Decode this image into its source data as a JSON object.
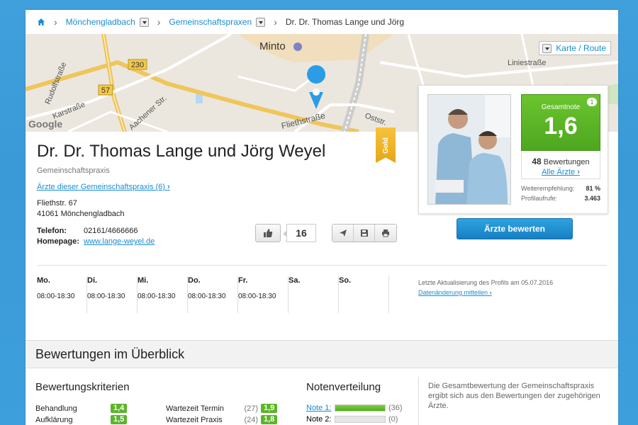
{
  "breadcrumb": {
    "items": [
      "Mönchengladbach",
      "Gemeinschaftspraxen",
      "Dr. Dr. Thomas Lange und Jörg"
    ]
  },
  "map": {
    "button_label": "Karte / Route",
    "labels": [
      "Minto",
      "230",
      "57",
      "Rudolfstraße",
      "Karstraße",
      "Aachener Str.",
      "Fliethstraße",
      "Liniestraße",
      "Oststr.",
      "Google"
    ]
  },
  "profile": {
    "name": "Dr. Dr. Thomas Lange und Jörg Weyel",
    "type": "Gemeinschaftspraxis",
    "doctors_link": "Ärzte dieser Gemeinschaftspraxis (6)",
    "address_line1": "Fliethstr. 67",
    "address_line2": "41061 Mönchengladbach",
    "phone_label": "Telefon:",
    "phone": "02161/4666666",
    "homepage_label": "Homepage:",
    "homepage": "www.lange-weyel.de",
    "badge": "Gold",
    "likes": "16"
  },
  "rating": {
    "label": "Gesamtnote",
    "value": "1,6",
    "badge_count": "1",
    "reviews_count": "48",
    "reviews_label": "Bewertungen",
    "all_doctors": "Alle Ärzte",
    "recommend_label": "Weiterempfehlung:",
    "recommend_value": "81 %",
    "views_label": "Profilaufrufe:",
    "views_value": "3.463",
    "rate_button": "Ärzte bewerten"
  },
  "hours": [
    {
      "day": "Mo.",
      "time": "08:00-18:30"
    },
    {
      "day": "Di.",
      "time": "08:00-18:30"
    },
    {
      "day": "Mi.",
      "time": "08:00-18:30"
    },
    {
      "day": "Do.",
      "time": "08:00-18:30"
    },
    {
      "day": "Fr.",
      "time": "08:00-18:30"
    },
    {
      "day": "Sa.",
      "time": ""
    },
    {
      "day": "So.",
      "time": ""
    }
  ],
  "update": {
    "text": "Letzte Aktualisierung des Profils am 05.07.2016",
    "link": "Datenänderung mitteilen"
  },
  "overview": {
    "title": "Bewertungen im Überblick",
    "criteria_title": "Bewertungskriterien",
    "criteria": [
      {
        "name": "Behandlung",
        "count": "",
        "grade": "1,4"
      },
      {
        "name": "Aufklärung",
        "count": "",
        "grade": "1,5"
      },
      {
        "name": "Wartezeit Termin",
        "count": "(27)",
        "grade": "1,9"
      },
      {
        "name": "Wartezeit Praxis",
        "count": "(24)",
        "grade": "1,8"
      }
    ],
    "distribution_title": "Notenverteilung",
    "distribution": [
      {
        "label": "Note 1:",
        "count": "(36)",
        "fraction": 1.0
      },
      {
        "label": "Note 2:",
        "count": "(0)",
        "fraction": 0.0
      }
    ],
    "note": "Die Gesamtbewertung der Gemeinschaftspraxis ergibt sich aus den Bewertungen der zugehörigen Ärzte."
  }
}
